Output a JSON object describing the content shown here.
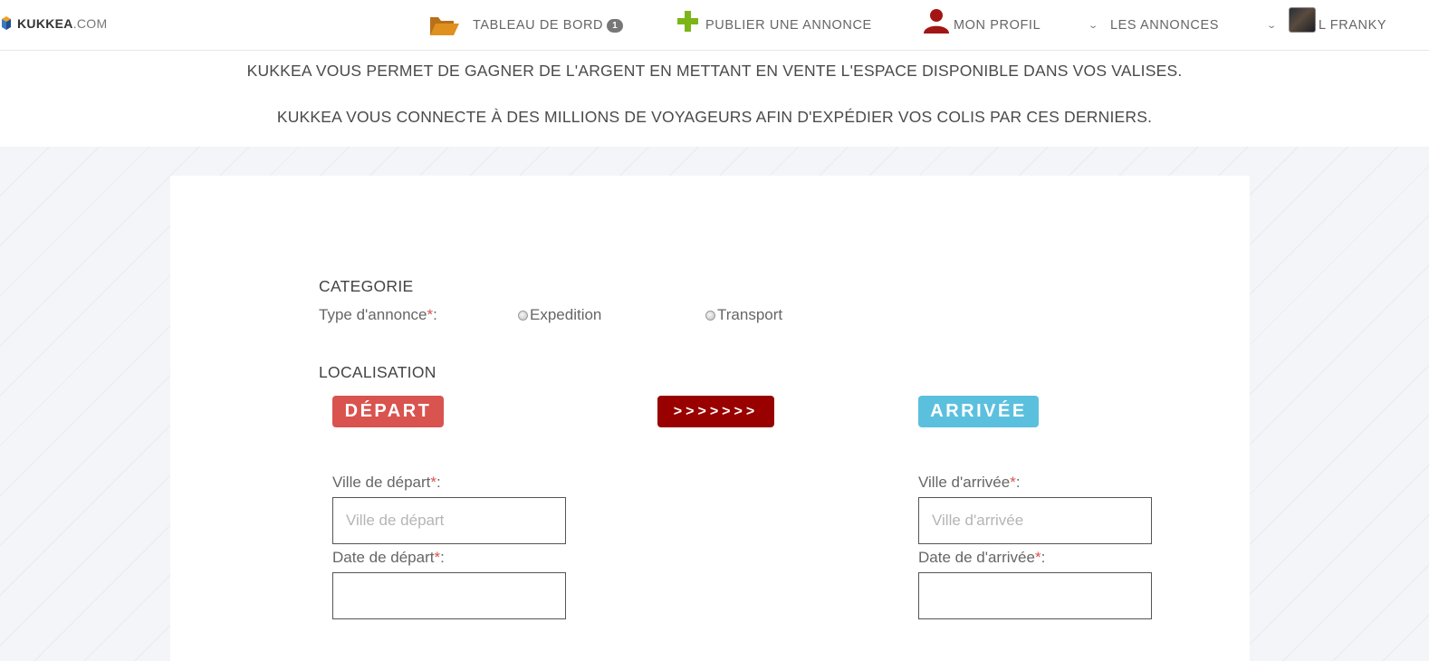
{
  "brand": {
    "name": "KUKKEA",
    "domain": ".COM"
  },
  "nav": {
    "dashboard": {
      "label": "TABLEAU DE BORD",
      "badge": "1",
      "icon": "folder-open-icon"
    },
    "publish": {
      "label": "PUBLIER UNE ANNONCE",
      "icon": "plus-icon"
    },
    "profile": {
      "label": "MON PROFIL",
      "icon": "user-icon"
    },
    "listings": {
      "label": "LES ANNONCES",
      "icon": "chevron-down-icon"
    },
    "user": {
      "label": "L FRANKY",
      "icon": "chevron-down-icon"
    }
  },
  "banner": {
    "line1": "KUKKEA VOUS PERMET DE GAGNER DE L'ARGENT EN METTANT EN VENTE L'ESPACE DISPONIBLE DANS VOS VALISES.",
    "line2": "KUKKEA VOUS CONNECTE À DES MILLIONS DE VOYAGEURS AFIN D'EXPÉDIER VOS COLIS PAR CES DERNIERS."
  },
  "form": {
    "category": {
      "title": "CATEGORIE",
      "type_label": "Type d'annonce",
      "options": [
        "Expedition",
        "Transport"
      ]
    },
    "location": {
      "title": "LOCALISATION",
      "depart_tag": "DÉPART",
      "arrow_tag": ">>>>>>>",
      "arrivee_tag": "ARRIVÉE",
      "depart_city_label": "Ville de départ",
      "depart_city_placeholder": "Ville de départ",
      "depart_date_label": "Date de départ",
      "arrival_city_label": "Ville d'arrivée",
      "arrival_city_placeholder": "Ville d'arrivée",
      "arrival_date_label": "Date de d'arrivée"
    },
    "required_mark": "*"
  },
  "colors": {
    "depart": "#d9534f",
    "arrow": "#990000",
    "arrivee": "#5bc0de",
    "required": "#d9534f",
    "folder_icon": "#d9891a",
    "plus_icon": "#7cb518",
    "user_icon": "#a31515"
  }
}
